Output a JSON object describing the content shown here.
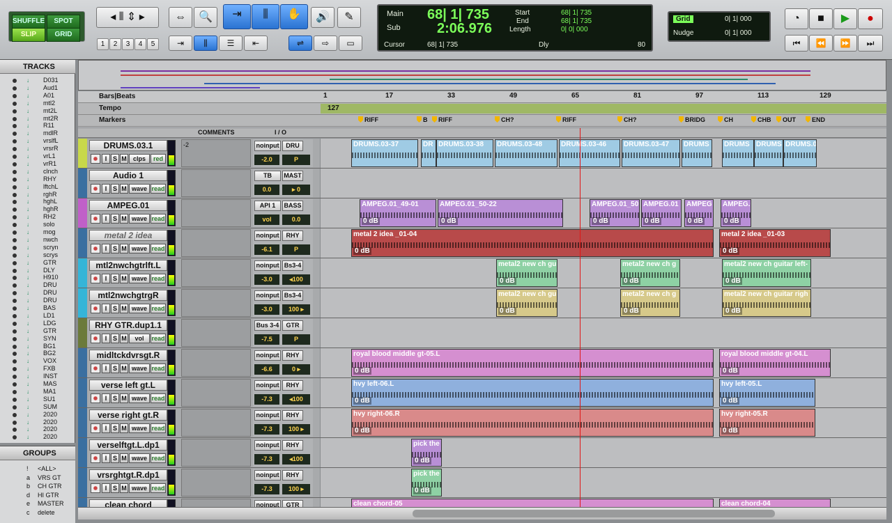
{
  "modes": {
    "shuffle": "SHUFFLE",
    "spot": "SPOT",
    "slip": "SLIP",
    "grid": "GRID"
  },
  "zoom_presets": [
    "1",
    "2",
    "3",
    "4",
    "5"
  ],
  "counters": {
    "main_label": "Main",
    "main_value": "68| 1| 735",
    "sub_label": "Sub",
    "sub_value": "2:06.976",
    "cursor_label": "Cursor",
    "cursor_value": "68| 1| 735",
    "start_label": "Start",
    "start_value": "68| 1| 735",
    "end_label": "End",
    "end_value": "68| 1| 735",
    "length_label": "Length",
    "length_value": "0| 0| 000",
    "dly_label": "Dly",
    "tempo_value": "80"
  },
  "grid": {
    "grid_label": "Grid",
    "grid_value": "0| 1| 000",
    "nudge_label": "Nudge",
    "nudge_value": "0| 1| 000"
  },
  "tracks_panel": {
    "title": "TRACKS",
    "items": [
      "D031",
      "Aud1",
      "A01",
      "mtl2",
      "mt2L",
      "mt2R",
      "R11",
      "mdlR",
      "vrslfL",
      "vrsrR",
      "vrL1",
      "vrR1",
      "clnch",
      "RHY",
      "lftchL",
      "rghR",
      "hghL",
      "hghR",
      "RH2",
      "solo",
      "mog",
      "nwch",
      "scryn",
      "scrys",
      "GTR",
      "DLY",
      "H910",
      "DRU",
      "DRU",
      "DRU",
      "BAS",
      "LD1",
      "LDG",
      "GTR",
      "SYN",
      "BG1",
      "BG2",
      "VOX",
      "FXB",
      "INST",
      "MAS",
      "MA1",
      "SU1",
      "SUM",
      "2020",
      "2020",
      "2020",
      "2020"
    ]
  },
  "groups_panel": {
    "title": "GROUPS",
    "items": [
      {
        "id": "!",
        "name": "<ALL>"
      },
      {
        "id": "a",
        "name": "VRS GT"
      },
      {
        "id": "b",
        "name": "CH GTR"
      },
      {
        "id": "d",
        "name": "HI GTR"
      },
      {
        "id": "e",
        "name": "MASTER"
      },
      {
        "id": "c",
        "name": "delete"
      }
    ]
  },
  "ruler": {
    "timebase": "Bars|Beats",
    "tempo_label": "Tempo",
    "tempo_value": "127",
    "markers_label": "Markers",
    "bars": [
      "1",
      "17",
      "33",
      "49",
      "65",
      "81",
      "97",
      "113",
      "129"
    ],
    "markers": [
      "RIFF",
      "B",
      "RIFF",
      "CH?",
      "RIFF",
      "CH?",
      "BRIDG",
      "CH",
      "CHB",
      "OUT",
      "END"
    ]
  },
  "columns": {
    "comments": "COMMENTS",
    "io": "I / O"
  },
  "tracks": [
    {
      "name": "DRUMS.03.1",
      "comment": "-2",
      "input": "noinput",
      "output": "DRU",
      "vol": "-2.0",
      "pan": "P",
      "pan2": "P",
      "view": "clps",
      "mode": "red",
      "color": "#c8d84a",
      "clips": [
        {
          "name": "DRUMS.03-37",
          "db": ""
        },
        {
          "name": "DR",
          "db": ""
        },
        {
          "name": "DRUMS.03-38",
          "db": ""
        },
        {
          "name": "DRUMS.03-48",
          "db": ""
        },
        {
          "name": "DRUMS.03-46",
          "db": ""
        },
        {
          "name": "DRUMS.03-47",
          "db": ""
        },
        {
          "name": "DRUMS",
          "db": ""
        },
        {
          "name": "DRUMS",
          "db": ""
        },
        {
          "name": "DRUMS",
          "db": ""
        },
        {
          "name": "DRUMS.0",
          "db": ""
        }
      ]
    },
    {
      "name": "Audio 1",
      "comment": "",
      "input": "TB",
      "output": "MAST",
      "vol": "0.0",
      "pan": "▸ 0",
      "view": "wave",
      "mode": "read",
      "color": "#3a6fa0",
      "clips": []
    },
    {
      "name": "AMPEG.01",
      "comment": "",
      "input": "API 1",
      "output": "BASS",
      "vol": "vol",
      "pan": "0.0",
      "view": "wave",
      "mode": "read",
      "color": "#c060c8",
      "clips": [
        {
          "name": "AMPEG.01_49-01",
          "db": "0 dB"
        },
        {
          "name": "AMPEG.01_50-22",
          "db": "0 dB"
        },
        {
          "name": "AMPEG.01_50",
          "db": "0 dB"
        },
        {
          "name": "AMPEG.01",
          "db": "0 dB"
        },
        {
          "name": "AMPEG",
          "db": "0 dB"
        },
        {
          "name": "AMPEG.01_51-0",
          "db": "0 dB"
        }
      ]
    },
    {
      "name": "metal 2 idea",
      "comment": "",
      "input": "noinput",
      "output": "RHY",
      "vol": "-6.1",
      "pan": "P",
      "pan2": "P",
      "view": "wave",
      "mode": "read",
      "color": "#3a6fa0",
      "clips": [
        {
          "name": "metal 2 idea _01-04",
          "db": "0 dB"
        },
        {
          "name": "metal 2 idea _01-03",
          "db": "0 dB"
        }
      ]
    },
    {
      "name": "mtl2nwchgtrlft.L",
      "comment": "",
      "input": "noinput",
      "output": "Bs3-4",
      "vol": "-3.0",
      "pan": "◂100",
      "view": "wave",
      "mode": "read",
      "color": "#35b5d8",
      "clips": [
        {
          "name": "metal2 new ch gu",
          "db": "0 dB"
        },
        {
          "name": "metal2 new ch g",
          "db": "0 dB"
        },
        {
          "name": "metal2 new ch guitar left-",
          "db": "0 dB"
        }
      ]
    },
    {
      "name": "mtl2nwchgtrgR",
      "comment": "",
      "input": "noinput",
      "output": "Bs3-4",
      "vol": "-3.0",
      "pan": "100 ▸",
      "view": "wave",
      "mode": "read",
      "color": "#35b5d8",
      "clips": [
        {
          "name": "metal2 new ch gu",
          "db": "0 dB"
        },
        {
          "name": "metal2 new ch g",
          "db": "0 dB"
        },
        {
          "name": "metal2 new ch guitar righ",
          "db": "0 dB"
        }
      ]
    },
    {
      "name": "RHY GTR.dup1.1",
      "comment": "",
      "input": "Bus 3-4",
      "output": "GTR",
      "vol": "-7.5",
      "pan": "P",
      "pan2": "P",
      "view": "vol",
      "mode": "read",
      "color": "#6b7a3a",
      "clips": []
    },
    {
      "name": "midltckdvrsgt.R",
      "comment": "",
      "input": "noinput",
      "output": "RHY",
      "vol": "-6.6",
      "pan": "0 ▸",
      "view": "wave",
      "mode": "read",
      "color": "#3a6fa0",
      "clips": [
        {
          "name": "royal blood middle gt-05.L",
          "db": "0 dB"
        },
        {
          "name": "royal blood middle gt-04.L",
          "db": "0 dB"
        }
      ]
    },
    {
      "name": "verse left gt.L",
      "comment": "",
      "input": "noinput",
      "output": "RHY",
      "vol": "-7.3",
      "pan": "◂100",
      "view": "wave",
      "mode": "read",
      "color": "#3a6fa0",
      "clips": [
        {
          "name": "hvy left-06.L",
          "db": "0 dB"
        },
        {
          "name": "hvy left-05.L",
          "db": "0 dB"
        }
      ]
    },
    {
      "name": "verse right gt.R",
      "comment": "",
      "input": "noinput",
      "output": "RHY",
      "vol": "-7.3",
      "pan": "100 ▸",
      "view": "wave",
      "mode": "read",
      "color": "#3a6fa0",
      "clips": [
        {
          "name": "hvy right-06.R",
          "db": "0 dB"
        },
        {
          "name": "hvy right-05.R",
          "db": "0 dB"
        }
      ]
    },
    {
      "name": "verselftgt.L.dp1",
      "comment": "",
      "input": "noinput",
      "output": "RHY",
      "vol": "-7.3",
      "pan": "◂100",
      "view": "wave",
      "mode": "read",
      "color": "#3a6fa0",
      "clips": [
        {
          "name": "pick the",
          "db": "0 dB"
        }
      ]
    },
    {
      "name": "vrsrghtgt.R.dp1",
      "comment": "",
      "input": "noinput",
      "output": "RHY",
      "vol": "-7.3",
      "pan": "100 ▸",
      "view": "wave",
      "mode": "read",
      "color": "#3a6fa0",
      "clips": [
        {
          "name": "pick the",
          "db": "0 dB"
        }
      ]
    },
    {
      "name": "clean chord",
      "comment": "",
      "input": "noinput",
      "output": "GTR",
      "vol": "",
      "pan": "",
      "view": "wave",
      "mode": "read",
      "color": "#3a6fa0",
      "clips": [
        {
          "name": "clean chord-05",
          "db": ""
        },
        {
          "name": "clean chord-04",
          "db": ""
        }
      ]
    }
  ]
}
